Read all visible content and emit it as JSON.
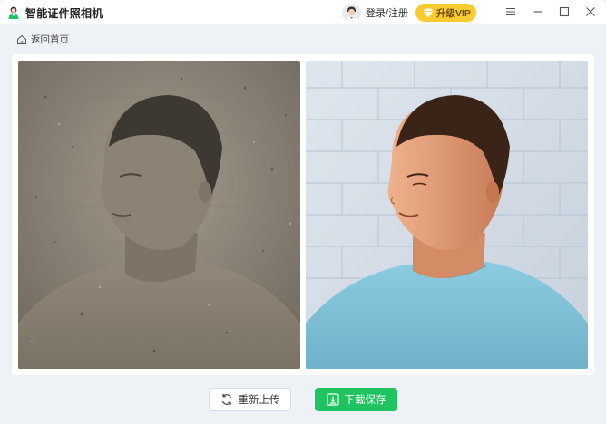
{
  "app": {
    "title": "智能证件照相机"
  },
  "header": {
    "login_label": "登录/注册",
    "vip_label": "升级VIP"
  },
  "nav": {
    "back_label": "返回首页"
  },
  "actions": {
    "reupload_label": "重新上传",
    "download_label": "下载保存"
  },
  "colors": {
    "accent_green": "#1fc35f",
    "vip_yellow": "#f8cc30",
    "background": "#eef1f5"
  },
  "icons": {
    "app_logo": "id-photo-person-icon",
    "menu": "hamburger-menu-icon",
    "minimize": "minimize-icon",
    "maximize": "maximize-icon",
    "close": "close-icon",
    "back": "home-icon",
    "reupload": "refresh-icon",
    "download": "download-icon"
  }
}
